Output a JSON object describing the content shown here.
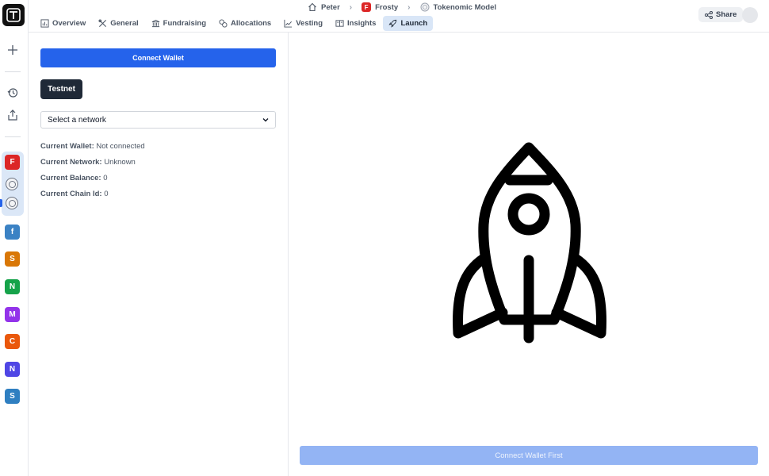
{
  "breadcrumbs": [
    {
      "label": "Peter",
      "icon": "home-icon"
    },
    {
      "label": "Frosty",
      "badge": "F"
    },
    {
      "label": "Tokenomic Model",
      "icon": "coin-icon"
    }
  ],
  "tabs": [
    {
      "label": "Overview",
      "icon": "chart-icon"
    },
    {
      "label": "General",
      "icon": "tools-icon"
    },
    {
      "label": "Fundraising",
      "icon": "bank-icon"
    },
    {
      "label": "Allocations",
      "icon": "coins-icon"
    },
    {
      "label": "Vesting",
      "icon": "trend-icon"
    },
    {
      "label": "Insights",
      "icon": "book-icon"
    },
    {
      "label": "Launch",
      "icon": "rocket-icon",
      "active": true
    }
  ],
  "header": {
    "share_label": "Share"
  },
  "sidebar": {
    "projects": [
      {
        "letter": "F",
        "color": "#dc2626"
      },
      {
        "letter": "f",
        "color": "#3b82c4"
      },
      {
        "letter": "S",
        "color": "#d97706"
      },
      {
        "letter": "N",
        "color": "#16a34a"
      },
      {
        "letter": "M",
        "color": "#9333ea"
      },
      {
        "letter": "C",
        "color": "#ea580c"
      },
      {
        "letter": "N",
        "color": "#4f46e5"
      },
      {
        "letter": "S",
        "color": "#2f7fc1"
      }
    ]
  },
  "wallet": {
    "connect_label": "Connect Wallet",
    "testnet_label": "Testnet",
    "network_placeholder": "Select a network",
    "info": [
      {
        "key": "Current Wallet:",
        "value": "Not connected"
      },
      {
        "key": "Current Network:",
        "value": "Unknown"
      },
      {
        "key": "Current Balance:",
        "value": "0"
      },
      {
        "key": "Current Chain Id:",
        "value": "0"
      }
    ]
  },
  "launch": {
    "button_label": "Connect Wallet First"
  },
  "colors": {
    "accent": "#2563eb",
    "accent_disabled": "#93b4f4",
    "active_tab": "#d9e6f7"
  }
}
